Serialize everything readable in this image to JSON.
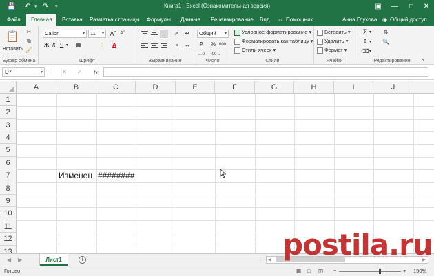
{
  "app": {
    "title": "Книга1 - Excel (Ознакомительная версия)",
    "accent": "#217346"
  },
  "tabs": {
    "items": [
      "Файл",
      "Главная",
      "Вставка",
      "Разметка страницы",
      "Формулы",
      "Данные",
      "Рецензирование",
      "Вид"
    ],
    "help": "Помощник",
    "user": "Анна Глухова",
    "share": "Общий доступ"
  },
  "ribbon": {
    "clipboard": {
      "label": "Буфер обмена",
      "paste": "Вставить"
    },
    "font": {
      "label": "Шрифт",
      "name": "Calibri",
      "size": "11",
      "bold": "Ж",
      "italic": "К",
      "underline": "Ч"
    },
    "alignment": {
      "label": "Выравнивание"
    },
    "number": {
      "label": "Число",
      "format": "Общий",
      "percent": "%",
      "thousands": "000"
    },
    "styles": {
      "label": "Стили",
      "conditional": "Условное форматирование",
      "table": "Форматировать как таблицу",
      "cell_styles": "Стили ячеек"
    },
    "cells": {
      "label": "Ячейки",
      "insert": "Вставить",
      "delete": "Удалить",
      "format": "Формат"
    },
    "editing": {
      "label": "Редактирование"
    }
  },
  "formula_bar": {
    "name_box": "D7",
    "fx": "fx",
    "value": ""
  },
  "grid": {
    "columns": [
      "A",
      "B",
      "C",
      "D",
      "E",
      "F",
      "G",
      "H",
      "I",
      "J"
    ],
    "rows": [
      "1",
      "2",
      "3",
      "4",
      "5",
      "6",
      "7",
      "8",
      "9",
      "10",
      "11",
      "12",
      "13"
    ],
    "cells": {
      "B7": "Изменен",
      "C7": "########"
    }
  },
  "sheets": {
    "active": "Лист1",
    "add": "+"
  },
  "status": {
    "ready": "Готово",
    "zoom": "150%"
  },
  "watermark": "postila.ru"
}
